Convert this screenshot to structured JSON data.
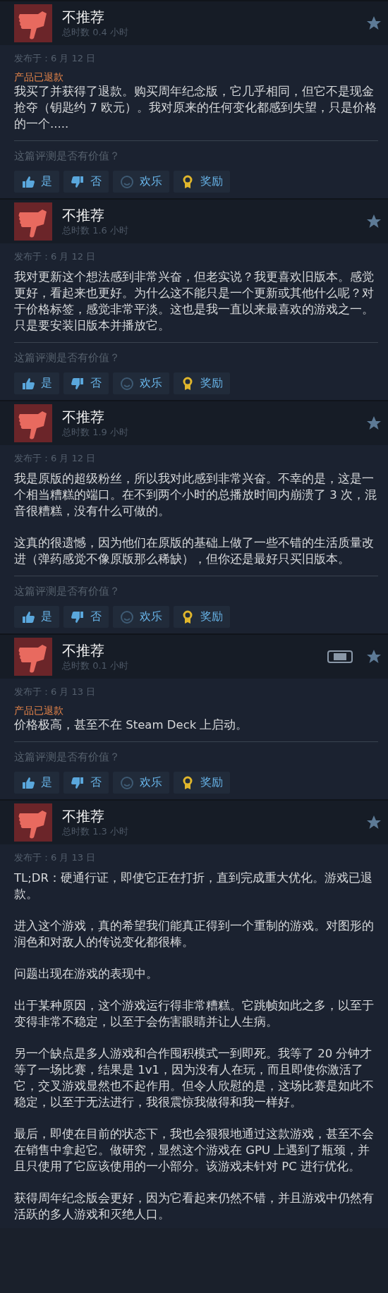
{
  "reviews": [
    {
      "verdict": "不推荐",
      "hours": "总时数 0.4 小时",
      "steam_deck": false,
      "posted": "发布于：6 月 12 日",
      "refunded": "产品已退款",
      "paragraphs": [
        "我买了并获得了退款。购买周年纪念版，它几乎相同，但它不是现金抢夺（钥匙约 7 欧元）。我对原来的任何变化都感到失望，只是价格的一个....."
      ],
      "helpful_question": "这篇评测是否有价值？",
      "buttons": [
        {
          "kind": "yes",
          "label": "是"
        },
        {
          "kind": "no",
          "label": "否"
        },
        {
          "kind": "funny",
          "label": "欢乐"
        },
        {
          "kind": "award",
          "label": "奖励"
        }
      ]
    },
    {
      "verdict": "不推荐",
      "hours": "总时数 1.6 小时",
      "steam_deck": false,
      "posted": "发布于：6 月 12 日",
      "paragraphs": [
        "我对更新这个想法感到非常兴奋，但老实说？我更喜欢旧版本。感觉更好，看起来也更好。为什么这不能只是一个更新或其他什么呢？对于价格标签，感觉非常平淡。这也是我一直以来最喜欢的游戏之一。只是要安装旧版本并播放它。"
      ],
      "helpful_question": "这篇评测是否有价值？",
      "buttons": [
        {
          "kind": "yes",
          "label": "是"
        },
        {
          "kind": "no",
          "label": "否"
        },
        {
          "kind": "funny",
          "label": "欢乐"
        },
        {
          "kind": "award",
          "label": "奖励"
        }
      ]
    },
    {
      "verdict": "不推荐",
      "hours": "总时数 1.9 小时",
      "steam_deck": false,
      "posted": "发布于：6 月 12 日",
      "paragraphs": [
        "我是原版的超级粉丝，所以我对此感到非常兴奋。不幸的是，这是一个相当糟糕的端口。在不到两个小时的总播放时间内崩溃了 3 次，混音很糟糕，没有什么可做的。",
        "这真的很遗憾，因为他们在原版的基础上做了一些不错的生活质量改进（弹药感觉不像原版那么稀缺），但你还是最好只买旧版本。"
      ],
      "helpful_question": "这篇评测是否有价值？",
      "buttons": [
        {
          "kind": "yes",
          "label": "是"
        },
        {
          "kind": "no",
          "label": "否"
        },
        {
          "kind": "funny",
          "label": "欢乐"
        },
        {
          "kind": "award",
          "label": "奖励"
        }
      ]
    },
    {
      "verdict": "不推荐",
      "hours": "总时数 0.1 小时",
      "steam_deck": true,
      "posted": "发布于：6 月 13 日",
      "refunded": "产品已退款",
      "paragraphs": [
        "价格极高，甚至不在 Steam Deck 上启动。"
      ],
      "helpful_question": "这篇评测是否有价值？",
      "buttons": [
        {
          "kind": "yes",
          "label": "是"
        },
        {
          "kind": "no",
          "label": "否"
        },
        {
          "kind": "funny",
          "label": "欢乐"
        },
        {
          "kind": "award",
          "label": "奖励"
        }
      ]
    },
    {
      "verdict": "不推荐",
      "hours": "总时数 1.3 小时",
      "steam_deck": false,
      "posted": "发布于：6 月 13 日",
      "paragraphs": [
        "TL;DR：硬通行证，即使它正在打折，直到完成重大优化。游戏已退款。",
        "进入这个游戏，真的希望我们能真正得到一个重制的游戏。对图形的润色和对敌人的传说变化都很棒。",
        "问题出现在游戏的表现中。",
        "出于某种原因，这个游戏运行得非常糟糕。它跳帧如此之多，以至于变得非常不稳定，以至于会伤害眼睛并让人生病。",
        "另一个缺点是多人游戏和合作囤积模式一到即死。我等了 20 分钟才等了一场比赛，结果是 1v1，因为没有人在玩，而且即使你激活了它，交叉游戏显然也不起作用。但令人欣慰的是，这场比赛是如此不稳定，以至于无法进行，我很震惊我做得和我一样好。",
        "最后，即使在目前的状态下，我也会狠狠地通过这款游戏，甚至不会在销售中拿起它。做研究，显然这个游戏在 GPU 上遇到了瓶颈，并且只使用了它应该使用的一小部分。该游戏未针对 PC 进行优化。",
        "获得周年纪念版会更好，因为它看起来仍然不错，并且游戏中仍然有活跃的多人游戏和灭绝人口。"
      ]
    }
  ]
}
